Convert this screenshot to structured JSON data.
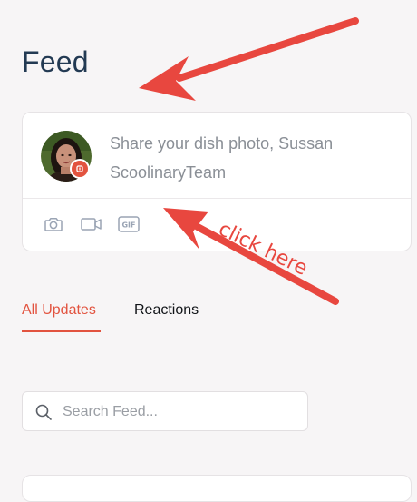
{
  "page": {
    "title": "Feed"
  },
  "composer": {
    "prompt": "Share your dish photo, Sussan ScoolinaryTeam",
    "avatar_icon": "user-avatar-photo",
    "actions": [
      {
        "name": "camera-icon"
      },
      {
        "name": "video-icon"
      },
      {
        "name": "gif-icon",
        "label": "GIF"
      }
    ]
  },
  "tabs": [
    {
      "label": "All Updates",
      "active": true
    },
    {
      "label": "Reactions",
      "active": false
    }
  ],
  "search": {
    "placeholder": "Search Feed..."
  },
  "annotation": {
    "note": "click here",
    "color": "#e8473f"
  },
  "colors": {
    "accent": "#e2533f",
    "title": "#233a53",
    "muted_text": "#8a8f96",
    "icon": "#9aa4b4"
  }
}
